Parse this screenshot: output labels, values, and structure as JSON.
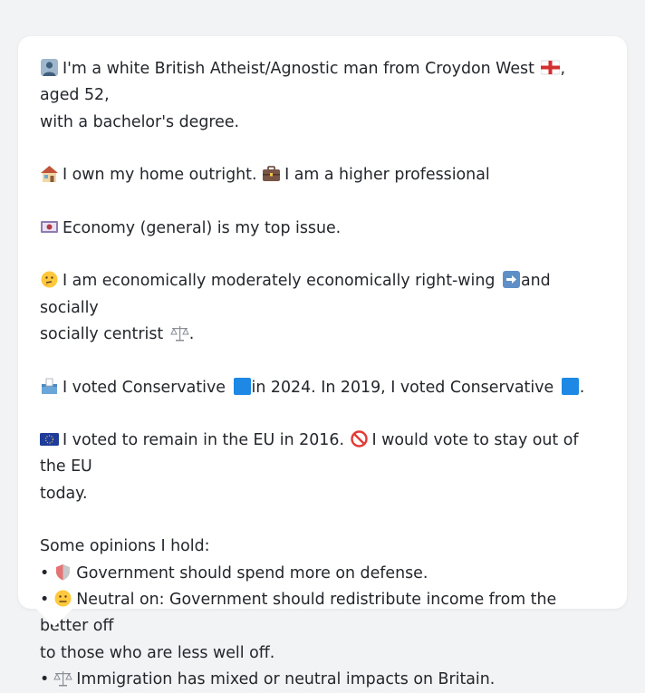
{
  "profile": {
    "identity_pre": "I'm a white British Atheist/Agnostic man from Croydon West",
    "identity_post": ", aged 52,",
    "identity_line2": "with a bachelor's degree.",
    "home": "I own my home outright.",
    "job": "I am a higher professional",
    "top_issue": "Economy (general) is my top issue.",
    "ideology_line1_pre": "I am economically moderately economically right-wing",
    "ideology_line1_post": "and socially",
    "ideology_line2_pre": "socially centrist",
    "ideology_line2_post": ".",
    "vote_part1": "I voted Conservative",
    "vote_part2": "in 2024. In 2019, I voted Conservative",
    "vote_part3": ".",
    "eu_part1": "I voted to remain in the EU in 2016.",
    "eu_part2": "I would vote to stay out of the EU",
    "eu_line2": "today."
  },
  "opinions": {
    "title": "Some opinions I hold:",
    "bullet": "•",
    "item1": "Government should spend more on defense.",
    "item2_line1": "Neutral on: Government should redistribute income from the better off",
    "item2_line2": "to those who are less well off.",
    "item3": "Immigration has mixed or neutral impacts on Britain."
  },
  "icons": {
    "person": "bust-in-silhouette-icon",
    "england_flag": "england-flag-icon",
    "house": "house-icon",
    "briefcase": "briefcase-icon",
    "money": "banknote-icon",
    "thinking": "thinking-face-icon",
    "right_arrow": "right-arrow-icon",
    "scales": "balance-scale-icon",
    "ballot": "ballot-box-icon",
    "blue_square": "blue-square-icon",
    "eu_flag": "eu-flag-icon",
    "prohibited": "prohibited-icon",
    "shield": "shield-icon",
    "neutral_face": "neutral-face-icon"
  },
  "colors": {
    "background": "#f2f3f5",
    "card": "#ffffff",
    "text": "#23262b",
    "conservative_blue": "#1e88e5"
  }
}
